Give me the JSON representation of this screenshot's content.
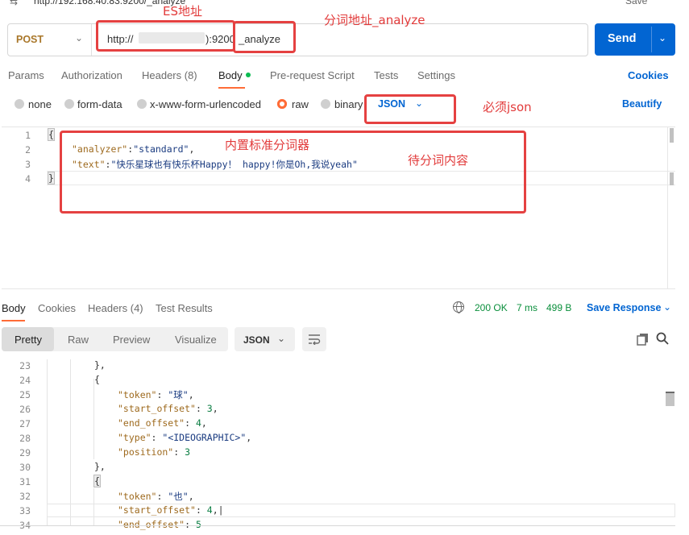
{
  "top": {
    "title": "http://192.168.40.83:9200/_analyze",
    "save_label": "Save"
  },
  "request": {
    "method": "POST",
    "url_prefix": "http://",
    "url_suffix": "):9200",
    "url_path": "_analyze",
    "send_label": "Send"
  },
  "tabs": [
    {
      "label": "Params"
    },
    {
      "label": "Authorization"
    },
    {
      "label": "Headers (8)"
    },
    {
      "label": "Body"
    },
    {
      "label": "Pre-request Script"
    },
    {
      "label": "Tests"
    },
    {
      "label": "Settings"
    }
  ],
  "cookies_label": "Cookies",
  "body_types": [
    {
      "label": "none",
      "checked": false
    },
    {
      "label": "form-data",
      "checked": false
    },
    {
      "label": "x-www-form-urlencoded",
      "checked": false
    },
    {
      "label": "raw",
      "checked": true
    },
    {
      "label": "binary",
      "checked": false
    }
  ],
  "raw_format": "JSON",
  "beautify_label": "Beautify",
  "request_body": {
    "line_numbers": [
      "1",
      "2",
      "3",
      "4"
    ],
    "open_brace": "{",
    "analyzer_key": "\"analyzer\"",
    "analyzer_value": "\"standard\"",
    "text_key": "\"text\"",
    "text_value": "\"快乐星球也有快乐杯Happy！ happy!你是Oh,我说yeah\"",
    "close_brace": "}"
  },
  "response": {
    "tabs": [
      {
        "label": "Body"
      },
      {
        "label": "Cookies"
      },
      {
        "label": "Headers (4)"
      },
      {
        "label": "Test Results"
      }
    ],
    "status": "200 OK",
    "time": "7 ms",
    "size": "499 B",
    "save_response_label": "Save Response",
    "view_modes": [
      "Pretty",
      "Raw",
      "Preview",
      "Visualize"
    ],
    "format": "JSON",
    "line_numbers": [
      "23",
      "24",
      "25",
      "26",
      "27",
      "28",
      "29",
      "30",
      "31",
      "32",
      "33",
      "34"
    ],
    "lines": {
      "l23": "},",
      "l24": "{",
      "l25_key": "\"token\"",
      "l25_val": "\"球\"",
      "l26_key": "\"start_offset\"",
      "l26_val": "3",
      "l27_key": "\"end_offset\"",
      "l27_val": "4",
      "l28_key": "\"type\"",
      "l28_val": "\"<IDEOGRAPHIC>\"",
      "l29_key": "\"position\"",
      "l29_val": "3",
      "l30": "},",
      "l31": "{",
      "l32_key": "\"token\"",
      "l32_val": "\"也\"",
      "l33_key": "\"start_offset\"",
      "l33_val": "4",
      "l34_key": "\"end_offset\"",
      "l34_val": "5"
    }
  },
  "annotations": {
    "es_address": "ES地址",
    "analyze_address": "分词地址_analyze",
    "must_json": "必须json",
    "builtin_analyzer": "内置标准分词器",
    "content_to_analyze": "待分词内容"
  },
  "colors": {
    "accent": "#ff6c37",
    "primary": "#0265d2",
    "annotation": "#e54141",
    "status_ok": "#0a8f3c"
  }
}
